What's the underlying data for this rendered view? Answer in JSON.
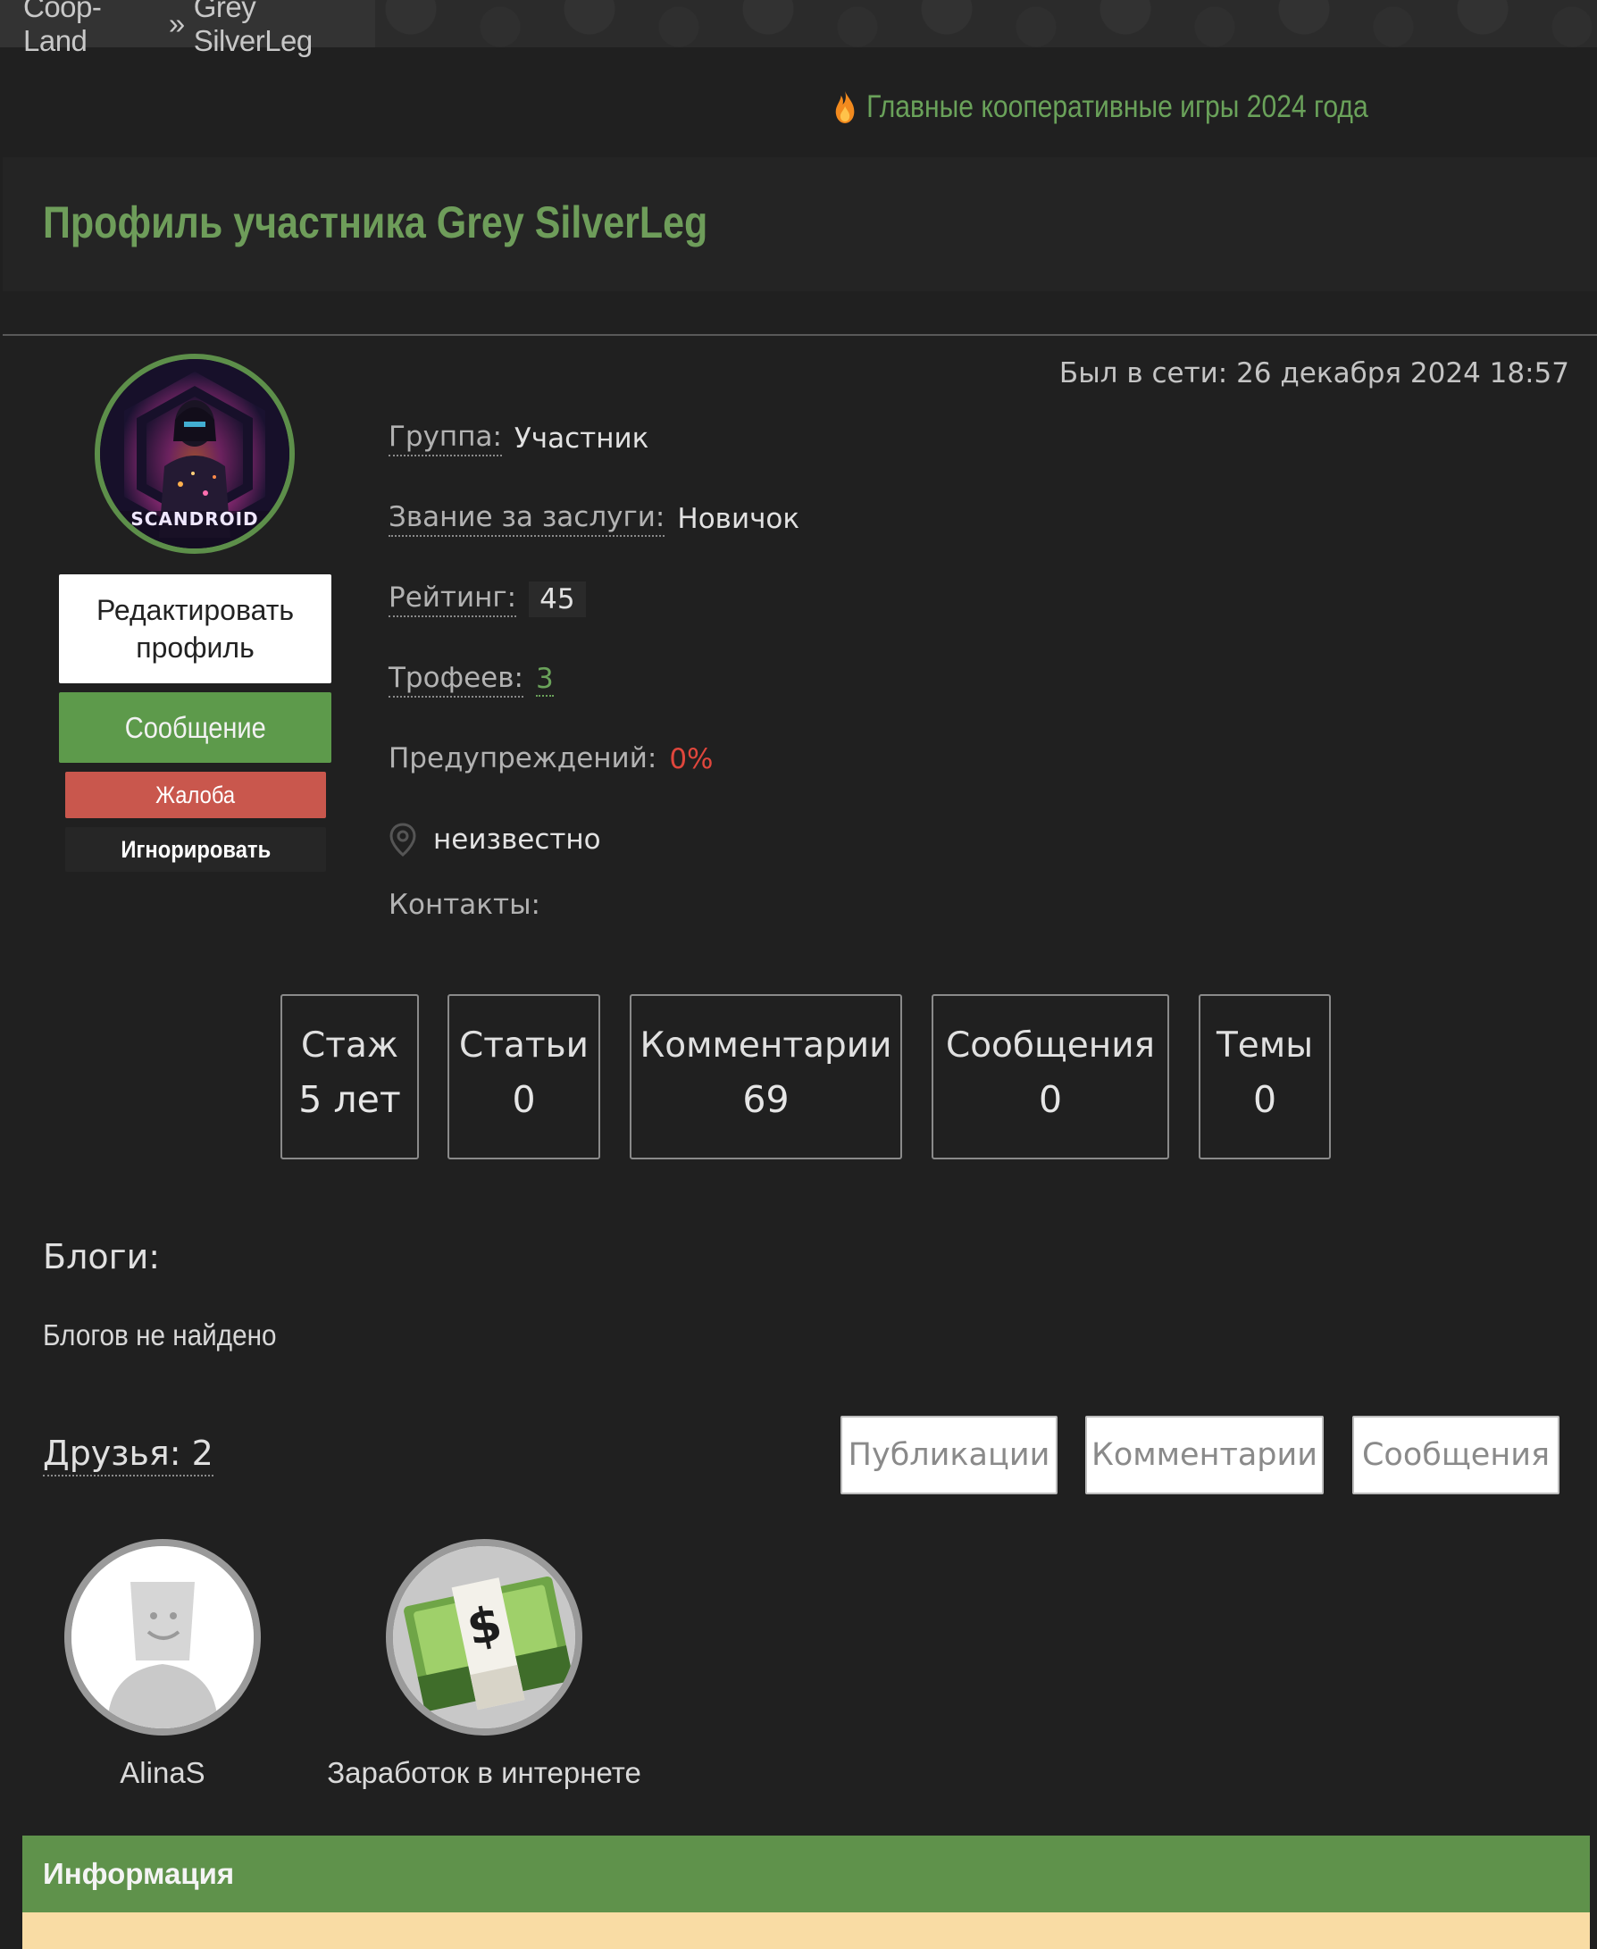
{
  "breadcrumb": {
    "site": "Coop-Land",
    "sep": "»",
    "current": "Grey SilverLeg"
  },
  "promo": {
    "text": "Главные кооперативные игры 2024 года",
    "icon": "flame-icon"
  },
  "page": {
    "title": "Профиль участника Grey SilverLeg"
  },
  "profile": {
    "last_seen": "Был в сети: 26 декабря 2024 18:57",
    "avatar_text": "SCANDROID",
    "buttons": {
      "edit": "Редактировать профиль",
      "message": "Сообщение",
      "report": "Жалоба",
      "ignore": "Игнорировать"
    },
    "fields": {
      "group_label": "Группа:",
      "group_value": "Участник",
      "rank_label": "Звание за заслуги:",
      "rank_value": "Новичок",
      "rating_label": "Рейтинг:",
      "rating_value": "45",
      "trophies_label": "Трофеев:",
      "trophies_value": "3",
      "warnings_label": "Предупреждений:",
      "warnings_value": "0%",
      "location_value": "неизвестно",
      "contacts_label": "Контакты:"
    }
  },
  "stats": [
    {
      "title": "Стаж",
      "value": "5 лет"
    },
    {
      "title": "Статьи",
      "value": "0"
    },
    {
      "title": "Комментарии",
      "value": "69"
    },
    {
      "title": "Сообщения",
      "value": "0"
    },
    {
      "title": "Темы",
      "value": "0"
    }
  ],
  "blogs": {
    "heading": "Блоги:",
    "empty": "Блогов не найдено"
  },
  "friends": {
    "heading": "Друзья: 2",
    "tabs": [
      "Публикации",
      "Комментарии",
      "Сообщения"
    ],
    "list": [
      {
        "name": "AlinaS"
      },
      {
        "name": "Заработок в интернете"
      }
    ]
  },
  "info": {
    "title": "Информация"
  },
  "colors": {
    "accent": "#5f924b",
    "title_green": "#6e9d5a",
    "danger": "#c9574d",
    "warning_text": "#e0463c"
  }
}
